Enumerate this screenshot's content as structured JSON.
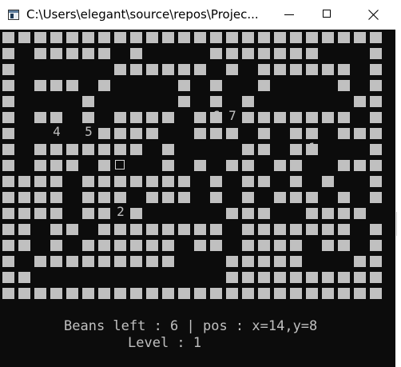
{
  "window": {
    "title": "C:\\Users\\elegant\\source\\repos\\Projec...",
    "icon": "console-app-icon",
    "controls": {
      "minimize": "minimize-icon",
      "maximize": "maximize-icon",
      "close": "close-icon"
    }
  },
  "colors": {
    "console_bg": "#0c0c0c",
    "wall": "#c0c0c0",
    "text": "#c0c0c0"
  },
  "maze": {
    "rows": [
      "########################",
      "#.#####.#....#######...#",
      "#......######.#.######.#",
      "#.###.#....#.#..#....#.#",
      "#....#.....#.#.#......##",
      "#.##.#.####.##.#######.#",
      "#.*.*.####..###.#.##.###",
      "#.#######.#....##.##.*.#",
      "#.###.#.P.#.#.##.##..###",
      "####.#######.#.##.#.#..#",
      "####.###.###.#.#.###.#.#",
      "####.##.#.....###..####.",
      "##.##.########.#######.#",
      "##.#.######.##.####.##.#",
      "#.#########...#####...##",
      "##............##########",
      "########################"
    ],
    "markers": [
      {
        "label": "4",
        "row": 6,
        "col": 3
      },
      {
        "label": "5",
        "row": 6,
        "col": 5
      },
      {
        "label": "6",
        "row": 5,
        "col": 13
      },
      {
        "label": "7",
        "row": 5,
        "col": 14
      },
      {
        "label": "1",
        "row": 7,
        "col": 19
      },
      {
        "label": "2",
        "row": 11,
        "col": 7
      }
    ],
    "player": {
      "row": 8,
      "col": 7
    }
  },
  "status": {
    "line1": "Beans left : 6 | pos : x=14,y=8",
    "line2": "Level : 1"
  }
}
